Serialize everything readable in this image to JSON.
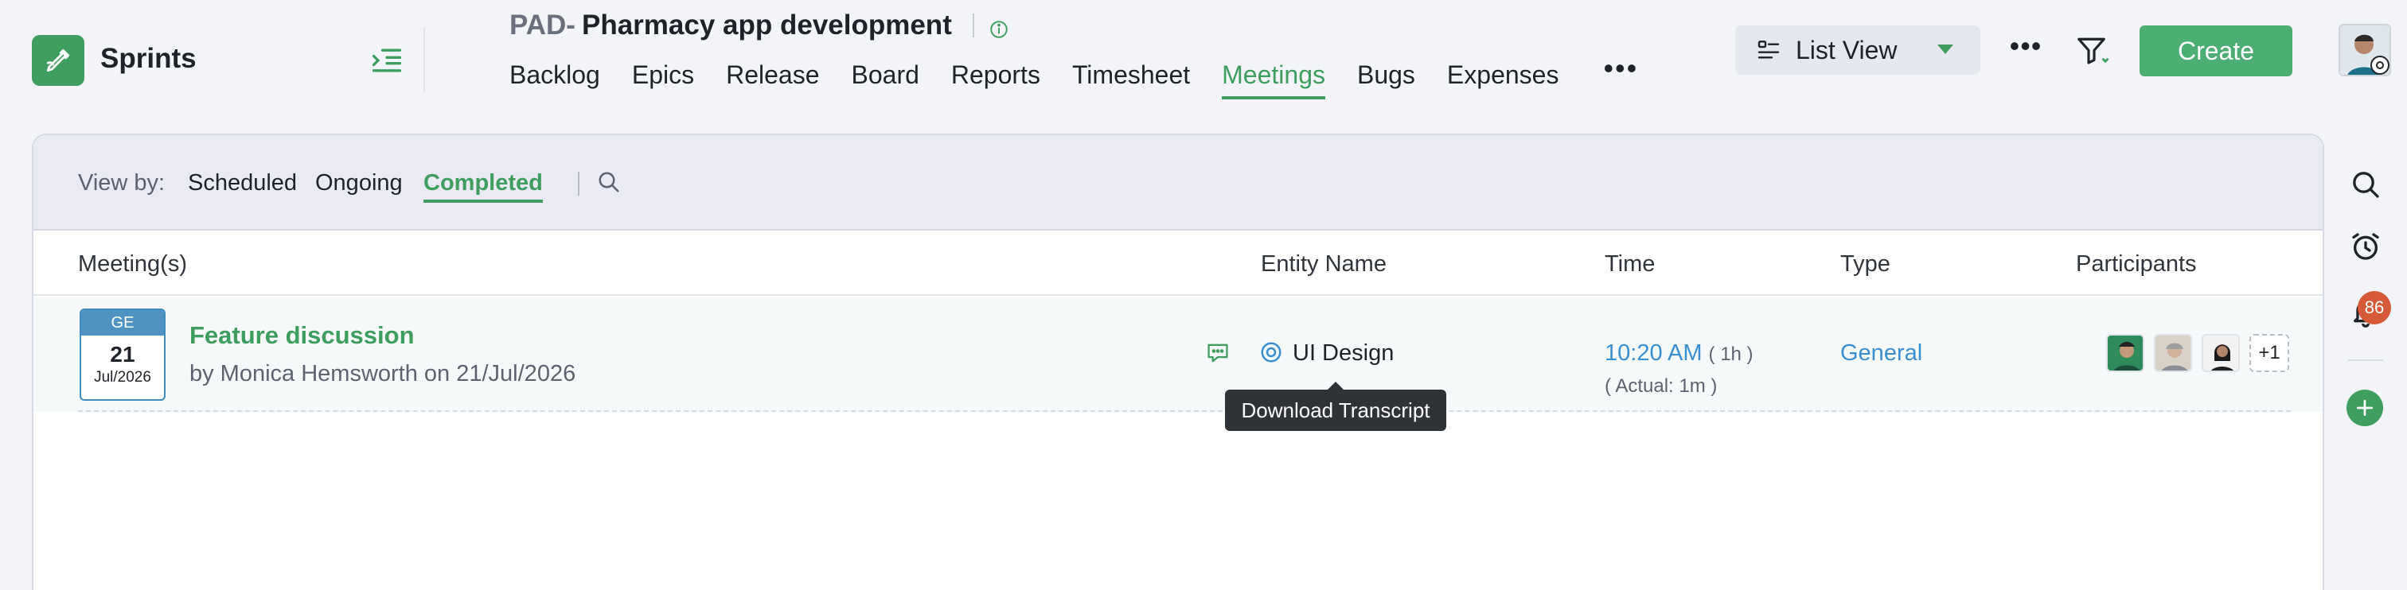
{
  "app": {
    "name": "Sprints"
  },
  "project": {
    "code": "PAD-",
    "name": "Pharmacy app development"
  },
  "nav": {
    "items": [
      "Backlog",
      "Epics",
      "Release",
      "Board",
      "Reports",
      "Timesheet",
      "Meetings",
      "Bugs",
      "Expenses"
    ],
    "active": "Meetings",
    "more": "•••"
  },
  "toolbar": {
    "view_label": "List View",
    "more": "•••",
    "create_label": "Create"
  },
  "view_by": {
    "label": "View by:",
    "options": [
      "Scheduled",
      "Ongoing",
      "Completed"
    ],
    "active": "Completed"
  },
  "table": {
    "headers": [
      "Meeting(s)",
      "Entity Name",
      "Time",
      "Type",
      "Participants"
    ],
    "rows": [
      {
        "date_type": "GE",
        "day": "21",
        "month_year": "Jul/2026",
        "title": "Feature discussion",
        "subtitle": "by Monica Hemsworth on 21/Jul/2026",
        "entity": "UI Design",
        "time": "10:20 AM",
        "duration": "( 1h )",
        "actual": "( Actual: 1m )",
        "type": "General",
        "participants_more": "+1"
      }
    ]
  },
  "tooltip": {
    "text": "Download Transcript"
  },
  "notifications": {
    "count": "86"
  },
  "icons": {
    "logo": "pen-icon",
    "collapse": "collapse-menu-icon",
    "info": "info-icon",
    "list_view": "list-view-icon",
    "filter": "filter-icon",
    "search": "search-icon",
    "transcript": "chat-transcript-icon",
    "entity": "entity-target-icon",
    "timer": "timer-icon",
    "bell": "bell-icon",
    "add": "plus-icon"
  },
  "colors": {
    "accent": "#3e9e5f",
    "link_blue": "#3a8fd0",
    "badge_red": "#d65a38",
    "create": "#4cae74"
  }
}
